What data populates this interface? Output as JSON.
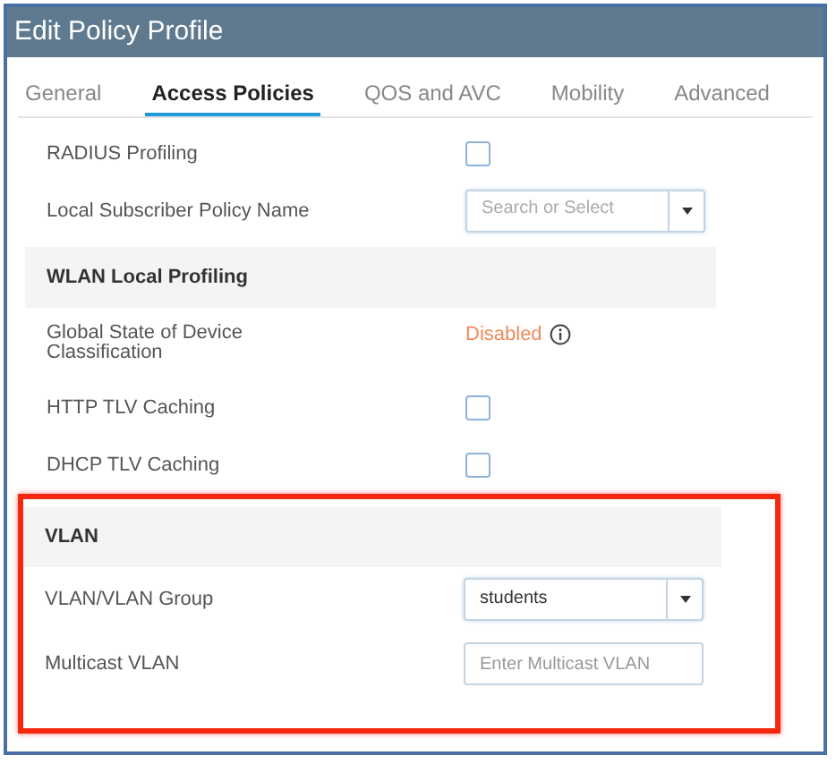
{
  "window": {
    "title": "Edit Policy Profile"
  },
  "tabs": [
    {
      "label": "General",
      "selected": false
    },
    {
      "label": "Access Policies",
      "selected": true
    },
    {
      "label": "QOS and AVC",
      "selected": false
    },
    {
      "label": "Mobility",
      "selected": false
    },
    {
      "label": "Advanced",
      "selected": false
    }
  ],
  "sections": [
    {
      "highlighted": false,
      "rows": [
        {
          "kind": "checkbox",
          "label": "RADIUS Profiling",
          "checked": false
        },
        {
          "kind": "select",
          "label": "Local Subscriber Policy Name",
          "placeholder": "Search or Select"
        }
      ]
    },
    {
      "title": "WLAN Local Profiling",
      "highlighted": false,
      "rows": [
        {
          "kind": "status",
          "label": "Global State of Device Classification",
          "value": "Disabled"
        },
        {
          "kind": "checkbox",
          "label": "HTTP TLV Caching",
          "checked": false
        },
        {
          "kind": "checkbox",
          "label": "DHCP TLV Caching",
          "checked": false
        }
      ]
    },
    {
      "title": "VLAN",
      "highlighted": true,
      "rows": [
        {
          "kind": "select",
          "label": "VLAN/VLAN Group",
          "value": "students"
        },
        {
          "kind": "input",
          "label": "Multicast VLAN",
          "placeholder": "Enter Multicast VLAN"
        }
      ]
    }
  ]
}
